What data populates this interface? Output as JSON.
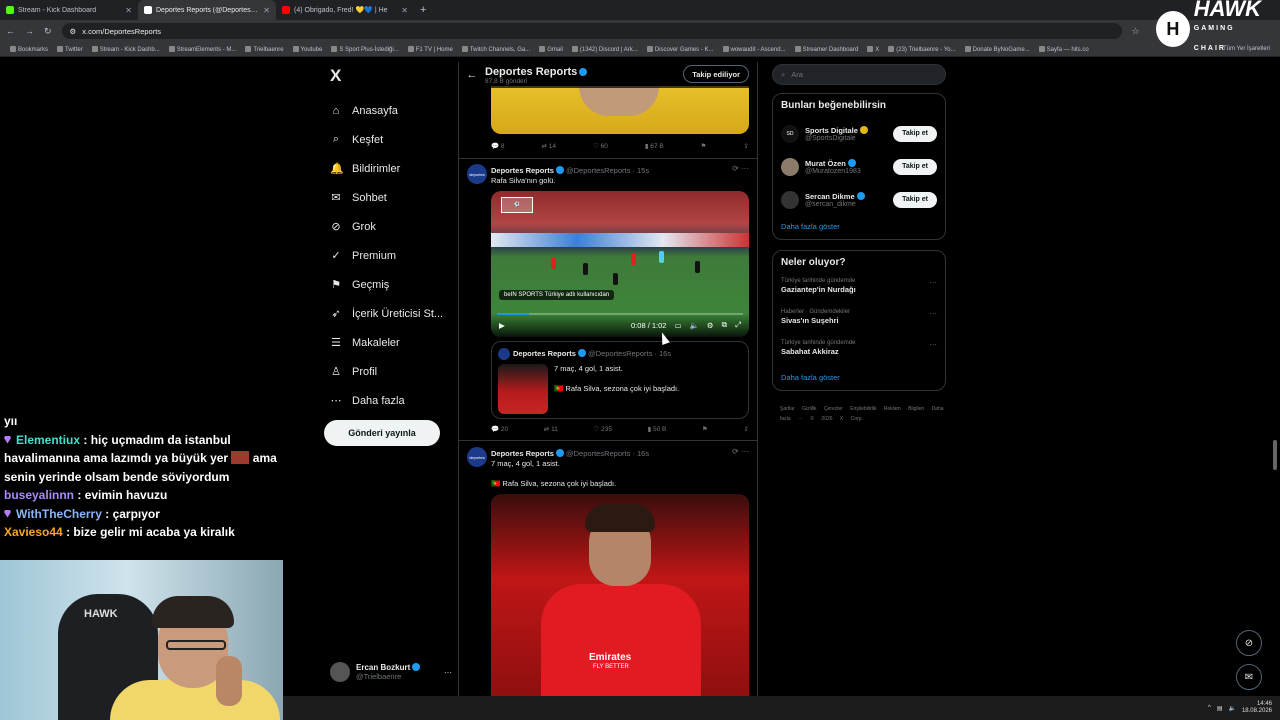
{
  "browser": {
    "tabs": [
      {
        "label": "Stream - Kick Dashboard",
        "color": "#53fc18"
      },
      {
        "label": "Deportes Reports (@DeportesRe",
        "color": "#ffffff"
      },
      {
        "label": "(4) Obrigado, Fred! 💛💙 | He",
        "color": "#ff0000"
      }
    ],
    "url": "x.com/DeportesReports",
    "bookmarks": [
      "Bookmarks",
      "Twitter",
      "Stream - Kick Dashb...",
      "StreamElements - M...",
      "Trielbaenre",
      "Youtube",
      "S Sport Plus-İstediği...",
      "F1 TV | Home",
      "Twitch Channels, Ga...",
      "Gmail",
      "(1342) Discord | Ark...",
      "Discover Games - K...",
      "wowaudit - Ascend...",
      "Streamer Dashboard",
      "X",
      "(23) Trielbaenre - Yo...",
      "Donate ByNoGame...",
      "Sayfa — hits.co"
    ],
    "bookmarks_right": "Tüm Yer İşaretleri"
  },
  "brand": {
    "initial": "H",
    "name": "HAWK",
    "sub": "GAMING CHAIR"
  },
  "nav": {
    "logo": "X",
    "items": [
      {
        "label": "Anasayfa",
        "icon": "⌂"
      },
      {
        "label": "Keşfet",
        "icon": "⌕"
      },
      {
        "label": "Bildirimler",
        "icon": "🔔"
      },
      {
        "label": "Sohbet",
        "icon": "✉"
      },
      {
        "label": "Grok",
        "icon": "⊘"
      },
      {
        "label": "Premium",
        "icon": "✓"
      },
      {
        "label": "Geçmiş",
        "icon": "⚑"
      },
      {
        "label": "İçerik Üreticisi St...",
        "icon": "➶"
      },
      {
        "label": "Makaleler",
        "icon": "☰"
      },
      {
        "label": "Profil",
        "icon": "♙"
      },
      {
        "label": "Daha fazla",
        "icon": "⋯"
      }
    ],
    "post_button": "Gönderi yayınla",
    "account": {
      "name": "Ercan Bozkurt",
      "handle": "@Trielbaenre",
      "menu": "···"
    }
  },
  "feed": {
    "title": "Deportes Reports",
    "subtitle": "87,8 B gönderi",
    "follow_label": "Takip ediliyor",
    "post0_actions": {
      "replies": "8",
      "reposts": "14",
      "likes": "60",
      "views": "67 B"
    },
    "post1": {
      "name": "Deportes Reports",
      "handle": "@DeportesReports · 15s",
      "text": "Rafa Silva'nın golü.",
      "video": {
        "credit": "beIN SPORTS Türkiye adlı kullanıcıdan",
        "time": "0:08 / 1:02",
        "progress": 0.13
      },
      "quote": {
        "name": "Deportes Reports",
        "handle": "@DeportesReports · 16s",
        "line1": "7 maç, 4 gol, 1 asist.",
        "line2": "🇵🇹 Rafa Silva, sezona çok iyi başladı."
      },
      "actions": {
        "replies": "20",
        "reposts": "11",
        "likes": "235",
        "views": "50 B"
      }
    },
    "post2": {
      "name": "Deportes Reports",
      "handle": "@DeportesReports · 16s",
      "line1": "7 maç, 4 gol, 1 asist.",
      "line2": "🇵🇹 Rafa Silva, sezona çok iyi başladı.",
      "image": {
        "sponsor": "Emirates",
        "sponsor2": "FLY BETTER"
      }
    },
    "avatar_text": "deportes"
  },
  "right": {
    "search_placeholder": "Ara",
    "suggest_title": "Bunları beğenebilirsin",
    "suggest": [
      {
        "name": "Sports Digitale",
        "handle": "@SportsDigitale",
        "button": "Takip et",
        "avatar": "SD",
        "color": "#111111"
      },
      {
        "name": "Murat Özen",
        "handle": "@Muratozen1983",
        "button": "Takip et",
        "avatar": "",
        "color": "#8a7a6a"
      },
      {
        "name": "Sercan Dikme",
        "handle": "@sercan_dikme",
        "button": "Takip et",
        "avatar": "",
        "color": "#333333"
      }
    ],
    "suggest_more": "Daha fazla göster",
    "trends_title": "Neler oluyor?",
    "trends": [
      {
        "context": "Türkiye tarihinde gündemde",
        "topic": "Gaziantep'in Nurdağı"
      },
      {
        "context": "Haberler · Gündemdekiler",
        "topic": "Sivas'ın Suşehri"
      },
      {
        "context": "Türkiye tarihinde gündemde",
        "topic": "Sabahat Akkiraz"
      }
    ],
    "trends_more": "Daha fazla göster",
    "footer": "Şartlar Gizlilik Çerezler Erişilebilirlik Reklam Bilgileri Daha fazla ··· © 2026 X Corp."
  },
  "chat": {
    "partial": "yıı",
    "messages": [
      {
        "user": "Elementiux",
        "color": "#3fe0d0",
        "badge": true,
        "text": ": hiç uçmadım da istanbul havalimanına ama lazımdı ya büyük yer",
        "emote": true,
        "text2": "ama senin yerinde olsam bende söviyordum"
      },
      {
        "user": "buseyalinnn",
        "color": "#a78bfa",
        "badge": false,
        "text": ": evimin havuzu"
      },
      {
        "user": "WithTheCherry",
        "color": "#8ab4f8",
        "badge": true,
        "text": ": çarpıyor"
      },
      {
        "user": "Xavieso44",
        "color": "#f5a623",
        "badge": false,
        "text": ": bize gelir mi acaba ya kiralık"
      }
    ]
  },
  "webcam": {
    "chair_brand": "HAWK"
  },
  "taskbar": {
    "time": "14:46",
    "date": "18.08.2026"
  }
}
